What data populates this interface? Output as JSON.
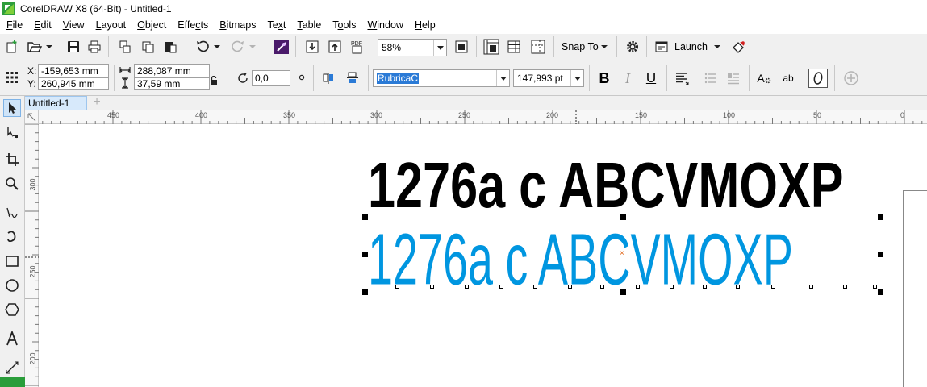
{
  "window": {
    "title": "CorelDRAW X8 (64-Bit) - Untitled-1"
  },
  "menu": {
    "items": [
      {
        "label": "File",
        "key": "F",
        "rest": "ile"
      },
      {
        "label": "Edit",
        "key": "E",
        "rest": "dit"
      },
      {
        "label": "View",
        "key": "V",
        "rest": "iew"
      },
      {
        "label": "Layout",
        "key": "L",
        "rest": "ayout"
      },
      {
        "label": "Object",
        "key": "O",
        "rest": "bject"
      },
      {
        "label": "Effects",
        "key": "",
        "pre": "Effe",
        "mid": "c",
        "rest": "ts"
      },
      {
        "label": "Bitmaps",
        "key": "B",
        "rest": "itmaps"
      },
      {
        "label": "Text",
        "key": "",
        "pre": "Te",
        "mid": "x",
        "rest": "t"
      },
      {
        "label": "Table",
        "key": "T",
        "rest": "able"
      },
      {
        "label": "Tools",
        "key": "",
        "pre": "T",
        "mid": "o",
        "rest": "ols"
      },
      {
        "label": "Window",
        "key": "W",
        "rest": "indow"
      },
      {
        "label": "Help",
        "key": "H",
        "rest": "elp"
      }
    ]
  },
  "standard_toolbar": {
    "zoom_value": "58%",
    "snap_to_label": "Snap To",
    "launch_label": "Launch"
  },
  "property_bar": {
    "x_label": "X:",
    "x_value": "-159,653 mm",
    "y_label": "Y:",
    "y_value": "260,945 mm",
    "width_value": "288,087 mm",
    "height_value": "37,59 mm",
    "rotation_value": "0,0",
    "font_name": "RubricaC",
    "font_size": "147,993 pt",
    "bold_label": "B",
    "italic_label": "I",
    "underline_label": "U",
    "char_format_label": "A",
    "text_edit_label": "ab"
  },
  "tabs": {
    "document_tab": "Untitled-1"
  },
  "ruler": {
    "h_labels": [
      "450",
      "400",
      "350",
      "300",
      "250",
      "200",
      "150",
      "100",
      "50",
      "0"
    ],
    "v_labels": [
      "300",
      "250",
      "200"
    ]
  },
  "canvas": {
    "text_black": "1276a c ABCVMOXP",
    "text_blue": "1276a c ABCVMOXP",
    "colors": {
      "black_text": "#000000",
      "blue_text": "#0096e0",
      "accent": "#2f8ce0"
    }
  }
}
